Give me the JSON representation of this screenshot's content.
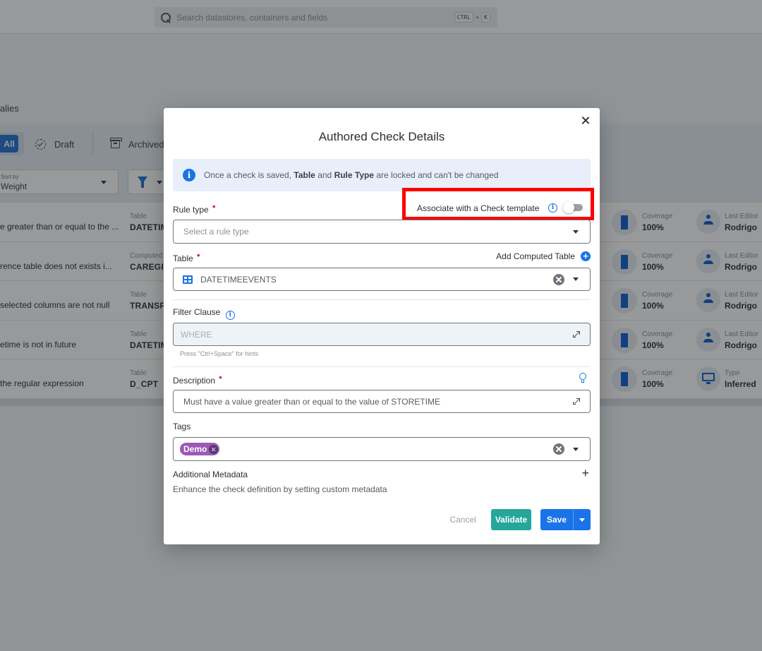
{
  "header": {
    "search_placeholder": "Search datastores, containers and fields",
    "shortcut_key1": "CTRL",
    "shortcut_plus": "+",
    "shortcut_key2": "K"
  },
  "page": {
    "breadcrumb_fragment": "alies",
    "tabs": [
      {
        "label": "All",
        "active": true
      },
      {
        "label": "Draft",
        "icon": "draft-icon"
      },
      {
        "label": "Archived",
        "icon": "archive-icon"
      }
    ],
    "sort": {
      "label": "Sort by",
      "value": "Weight"
    },
    "rows": [
      {
        "description": "e greater than or equal to the ...",
        "type_label": "Table",
        "type_value": "DATETIM",
        "coverage_label": "Coverage",
        "coverage_value": "100%",
        "meta_label": "Last Editor",
        "meta_value": "Rodrigo",
        "meta_icon": "person-icon"
      },
      {
        "description": "rence table does not exists i...",
        "type_label": "Computed",
        "type_value": "CAREGIV",
        "coverage_label": "Coverage",
        "coverage_value": "100%",
        "meta_label": "Last Editor",
        "meta_value": "Rodrigo",
        "meta_icon": "person-icon"
      },
      {
        "description": "selected columns are not null",
        "type_label": "Table",
        "type_value": "TRANSFE",
        "coverage_label": "Coverage",
        "coverage_value": "100%",
        "meta_label": "Last Editor",
        "meta_value": "Rodrigo",
        "meta_icon": "person-icon"
      },
      {
        "description": "etime is not in future",
        "type_label": "Table",
        "type_value": "DATETIM",
        "coverage_label": "Coverage",
        "coverage_value": "100%",
        "meta_label": "Last Editor",
        "meta_value": "Rodrigo",
        "meta_icon": "person-icon"
      },
      {
        "description": "the regular expression",
        "type_label": "Table",
        "type_value": "D_CPT",
        "coverage_label": "Coverage",
        "coverage_value": "100%",
        "meta_label": "Type",
        "meta_value": "Inferred",
        "meta_icon": "monitor-icon"
      }
    ]
  },
  "modal": {
    "title": "Authored Check Details",
    "info": {
      "prefix": "Once a check is saved, ",
      "bold1": "Table",
      "mid": " and ",
      "bold2": "Rule Type",
      "suffix": " are locked and can't be changed"
    },
    "rule_type": {
      "label": "Rule type",
      "placeholder": "Select a rule type",
      "required": true
    },
    "template_toggle": {
      "label": "Associate with a Check template",
      "enabled": false
    },
    "table": {
      "label": "Table",
      "value": "DATETIMEEVENTS",
      "required": true,
      "add_computed_label": "Add Computed Table"
    },
    "filter_clause": {
      "label": "Filter Clause",
      "placeholder": "WHERE",
      "hint": "Press \"Ctrl+Space\" for hints"
    },
    "description": {
      "label": "Description",
      "value": "Must have a value greater than or equal to the value of STORETIME",
      "required": true
    },
    "tags": {
      "label": "Tags",
      "items": [
        {
          "label": "Demo",
          "color": "#9b59b6"
        }
      ]
    },
    "metadata": {
      "title": "Additional Metadata",
      "description": "Enhance the check definition by setting custom metadata"
    },
    "buttons": {
      "cancel": "Cancel",
      "validate": "Validate",
      "save": "Save"
    }
  },
  "colors": {
    "primary": "#1a73e8",
    "validate": "#26a69a",
    "required": "#e0245e",
    "highlight_box": "#ff0000",
    "tag": "#9b59b6"
  }
}
